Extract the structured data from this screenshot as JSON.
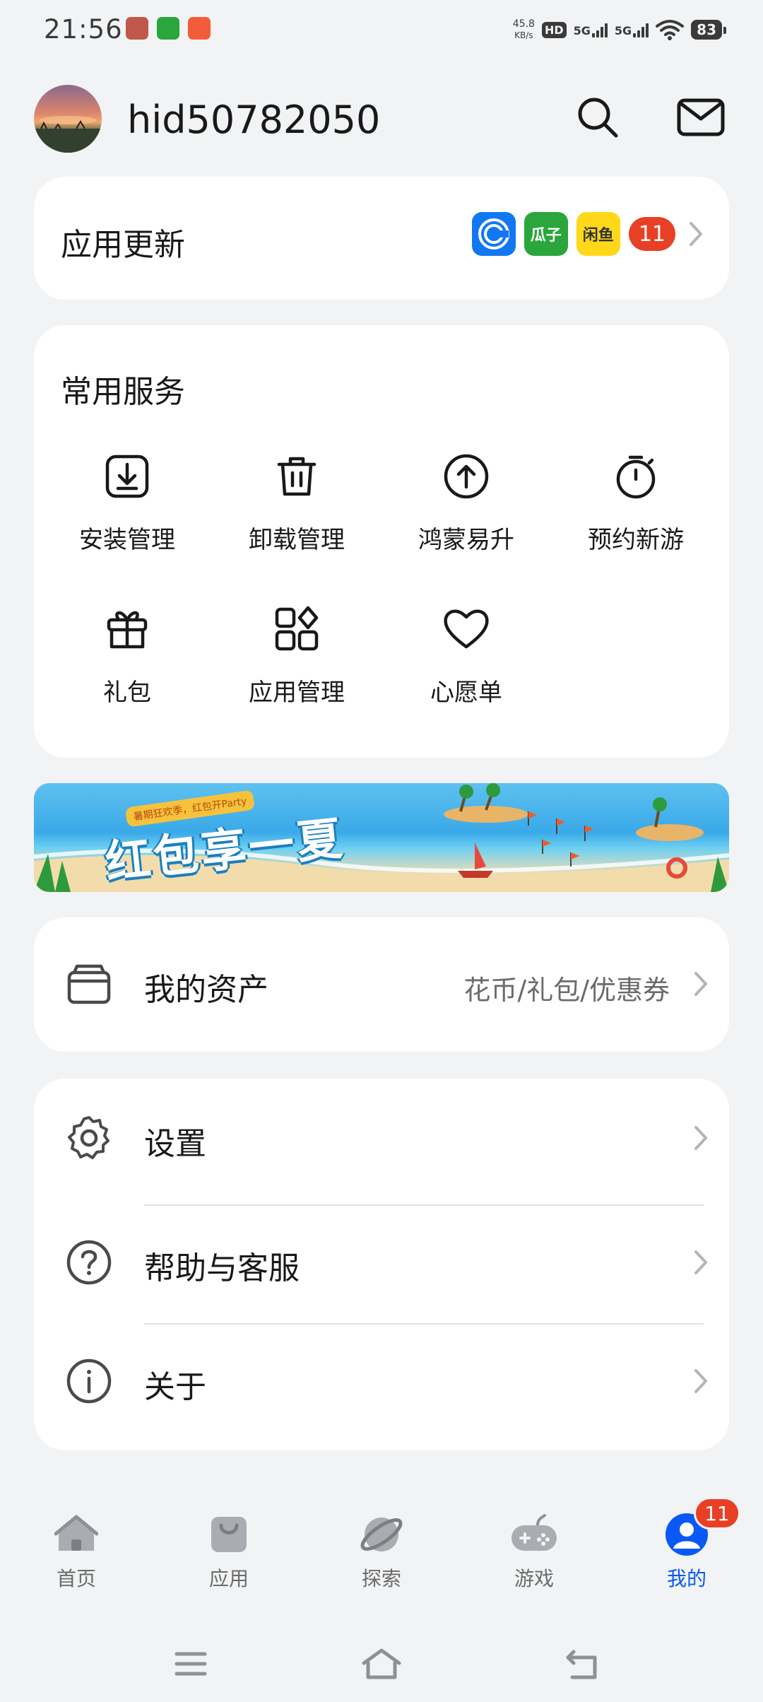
{
  "status_bar": {
    "time": "21:56",
    "apps": [
      "王者",
      "瓜子",
      "贝壳"
    ],
    "net_speed_value": "45.8",
    "net_speed_unit": "KB/s",
    "hd_label": "HD",
    "sig1": "5G",
    "sig2": "5G",
    "battery": "83"
  },
  "header": {
    "username": "hid50782050"
  },
  "update_card": {
    "title": "应用更新",
    "apps": [
      {
        "name": "C",
        "color": "#1277f2"
      },
      {
        "name": "瓜子",
        "color": "#2aa63c"
      },
      {
        "name": "闲鱼",
        "color": "#ffd81a"
      }
    ],
    "count": "11"
  },
  "services": {
    "title": "常用服务",
    "items": [
      {
        "label": "安装管理",
        "icon": "install-icon"
      },
      {
        "label": "卸载管理",
        "icon": "trash-icon"
      },
      {
        "label": "鸿蒙易升",
        "icon": "upgrade-icon"
      },
      {
        "label": "预约新游",
        "icon": "stopwatch-icon"
      },
      {
        "label": "礼包",
        "icon": "gift-icon"
      },
      {
        "label": "应用管理",
        "icon": "app-grid-icon"
      },
      {
        "label": "心愿单",
        "icon": "heart-icon"
      }
    ]
  },
  "banner": {
    "title": "红包享一夏",
    "subtitle": "暑期狂欢季，红包开Party"
  },
  "assets": {
    "label": "我的资产",
    "detail": "花币/礼包/优惠券"
  },
  "settings_list": [
    {
      "label": "设置",
      "icon": "gear-icon"
    },
    {
      "label": "帮助与客服",
      "icon": "help-icon"
    },
    {
      "label": "关于",
      "icon": "info-icon"
    }
  ],
  "tabbar": {
    "tabs": [
      {
        "label": "首页"
      },
      {
        "label": "应用"
      },
      {
        "label": "探索"
      },
      {
        "label": "游戏"
      },
      {
        "label": "我的"
      }
    ],
    "me_badge": "11",
    "active_color": "#0a59f7"
  }
}
